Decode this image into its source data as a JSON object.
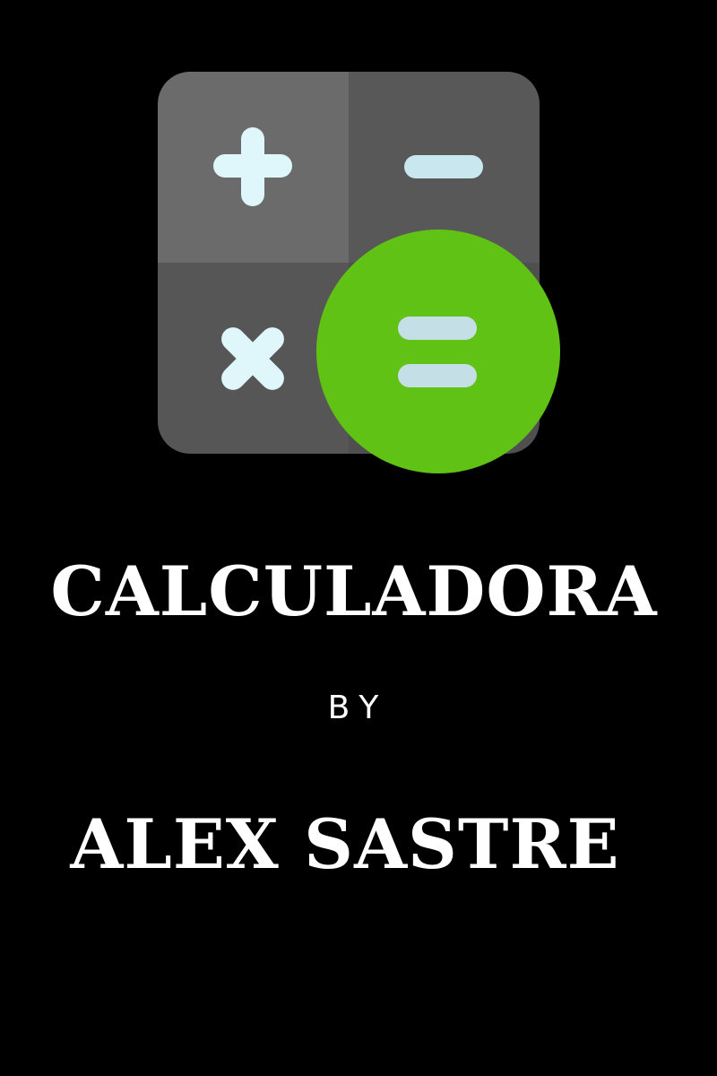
{
  "cover": {
    "title": "CALCULADORA",
    "by_label": "BY",
    "author": "ALEX SASTRE"
  },
  "logo": {
    "icon": "calculator-icon",
    "quadrant_icons": [
      "plus-icon",
      "minus-icon",
      "multiply-icon",
      "equals-icon"
    ],
    "colors": {
      "tile_light": "#6b6b6b",
      "tile_dark": "#565656",
      "symbol": "#dff6fb",
      "equals_circle": "#5fc215",
      "equals_symbol": "#c5dfe6",
      "background": "#000000"
    }
  }
}
